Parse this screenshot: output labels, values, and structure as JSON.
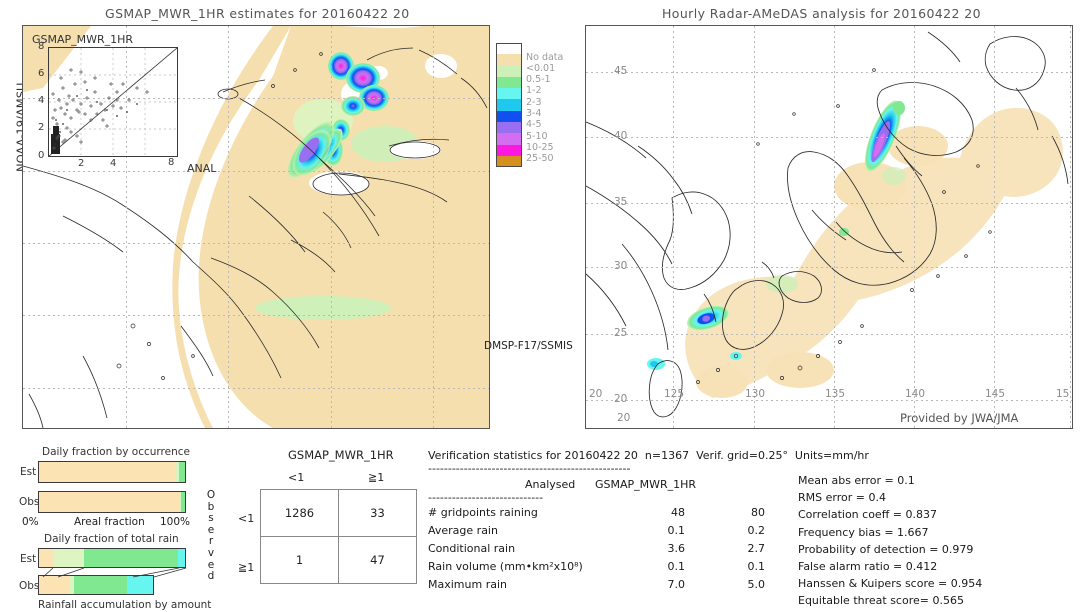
{
  "left_panel": {
    "title": "GSMAP_MWR_1HR estimates for 20160422 20",
    "vertical_label": "NOAA-19/AMSU",
    "inset_label": "GSMAP_MWR_1HR",
    "inset_xlabel": "ANAL",
    "inset_ticks": [
      "0",
      "2",
      "4",
      "6",
      "8"
    ],
    "sensor_label": "DMSP-F17/SSMIS"
  },
  "right_panel": {
    "title": "Hourly Radar-AMeDAS analysis for 20160422 20",
    "credit": "Provided by JWA/JMA",
    "xticks": [
      "20",
      "125",
      "130",
      "135",
      "140",
      "145",
      "15"
    ],
    "yticks": [
      "45",
      "40",
      "35",
      "30",
      "25",
      "20"
    ],
    "corner_label": "20"
  },
  "colorbar": {
    "labels": [
      "No data",
      "<0.01",
      "0.5-1",
      "1-2",
      "2-3",
      "3-4",
      "4-5",
      "5-10",
      "10-25",
      "25-50"
    ],
    "colors": [
      "#ffffff",
      "#f5dfae",
      "#ccf0b8",
      "#7fe890",
      "#67f5f0",
      "#1ec8ee",
      "#1050f0",
      "#9a6ef0",
      "#d46ef0",
      "#ff18e0",
      "#d69020"
    ]
  },
  "bar_occurrence": {
    "title": "Daily fraction by occurrence",
    "xlabel": "Areal fraction",
    "xmin": "0%",
    "xmax": "100%",
    "rows": [
      {
        "label": "Est",
        "segments": [
          {
            "color": "#fbe3b4",
            "pct": 93.5
          },
          {
            "color": "#d8f3bd",
            "pct": 2.5
          },
          {
            "color": "#7fe890",
            "pct": 4.0
          }
        ]
      },
      {
        "label": "Obs",
        "segments": [
          {
            "color": "#fbe3b4",
            "pct": 96.5
          },
          {
            "color": "#d8f3bd",
            "pct": 1.0
          },
          {
            "color": "#7fe890",
            "pct": 2.5
          }
        ]
      }
    ]
  },
  "bar_total_rain": {
    "title": "Daily fraction of total rain",
    "xlabel": "Rainfall accumulation by amount",
    "rows": [
      {
        "label": "Est",
        "width_pct": 100,
        "segments": [
          {
            "color": "#fbe3b4",
            "pct": 10.0
          },
          {
            "color": "#ddf5c2",
            "pct": 21.0
          },
          {
            "color": "#7fe890",
            "pct": 64.0
          },
          {
            "color": "#67f5f0",
            "pct": 5.0
          }
        ]
      },
      {
        "label": "Obs",
        "width_pct": 78,
        "segments": [
          {
            "color": "#fbe3b4",
            "pct": 27.0
          },
          {
            "color": "#ddf5c2",
            "pct": 4.0
          },
          {
            "color": "#7fe890",
            "pct": 46.0
          },
          {
            "color": "#67f5f0",
            "pct": 23.0
          }
        ]
      }
    ]
  },
  "contingency": {
    "title": "GSMAP_MWR_1HR",
    "col_headers": [
      "<1",
      "≧1"
    ],
    "row_headers": [
      "<1",
      "≧1"
    ],
    "side_label": "Observed",
    "cells": [
      [
        "1286",
        "33"
      ],
      [
        "1",
        "47"
      ]
    ]
  },
  "stats": {
    "header": "Verification statistics for 20160422 20  n=1367  Verif. grid=0.25°  Units=mm/hr",
    "divider": "---------------------------------------------------",
    "col_headers": [
      "Analysed",
      "GSMAP_MWR_1HR"
    ],
    "sub_divider": "-----------------------------",
    "rows": [
      {
        "name": "# gridpoints raining",
        "analysed": "48",
        "estimate": "80"
      },
      {
        "name": "Average rain",
        "analysed": "0.1",
        "estimate": "0.2"
      },
      {
        "name": "Conditional rain",
        "analysed": "3.6",
        "estimate": "2.7"
      },
      {
        "name": "Rain volume (mm•km²x10⁸)",
        "analysed": "0.1",
        "estimate": "0.1"
      },
      {
        "name": "Maximum rain",
        "analysed": "7.0",
        "estimate": "5.0"
      }
    ],
    "scores": [
      "Mean abs error = 0.1",
      "RMS error = 0.4",
      "Correlation coeff = 0.837",
      "Frequency bias = 1.667",
      "Probability of detection = 0.979",
      "False alarm ratio = 0.412",
      "Hanssen & Kuipers score = 0.954",
      "Equitable threat score= 0.565"
    ]
  }
}
